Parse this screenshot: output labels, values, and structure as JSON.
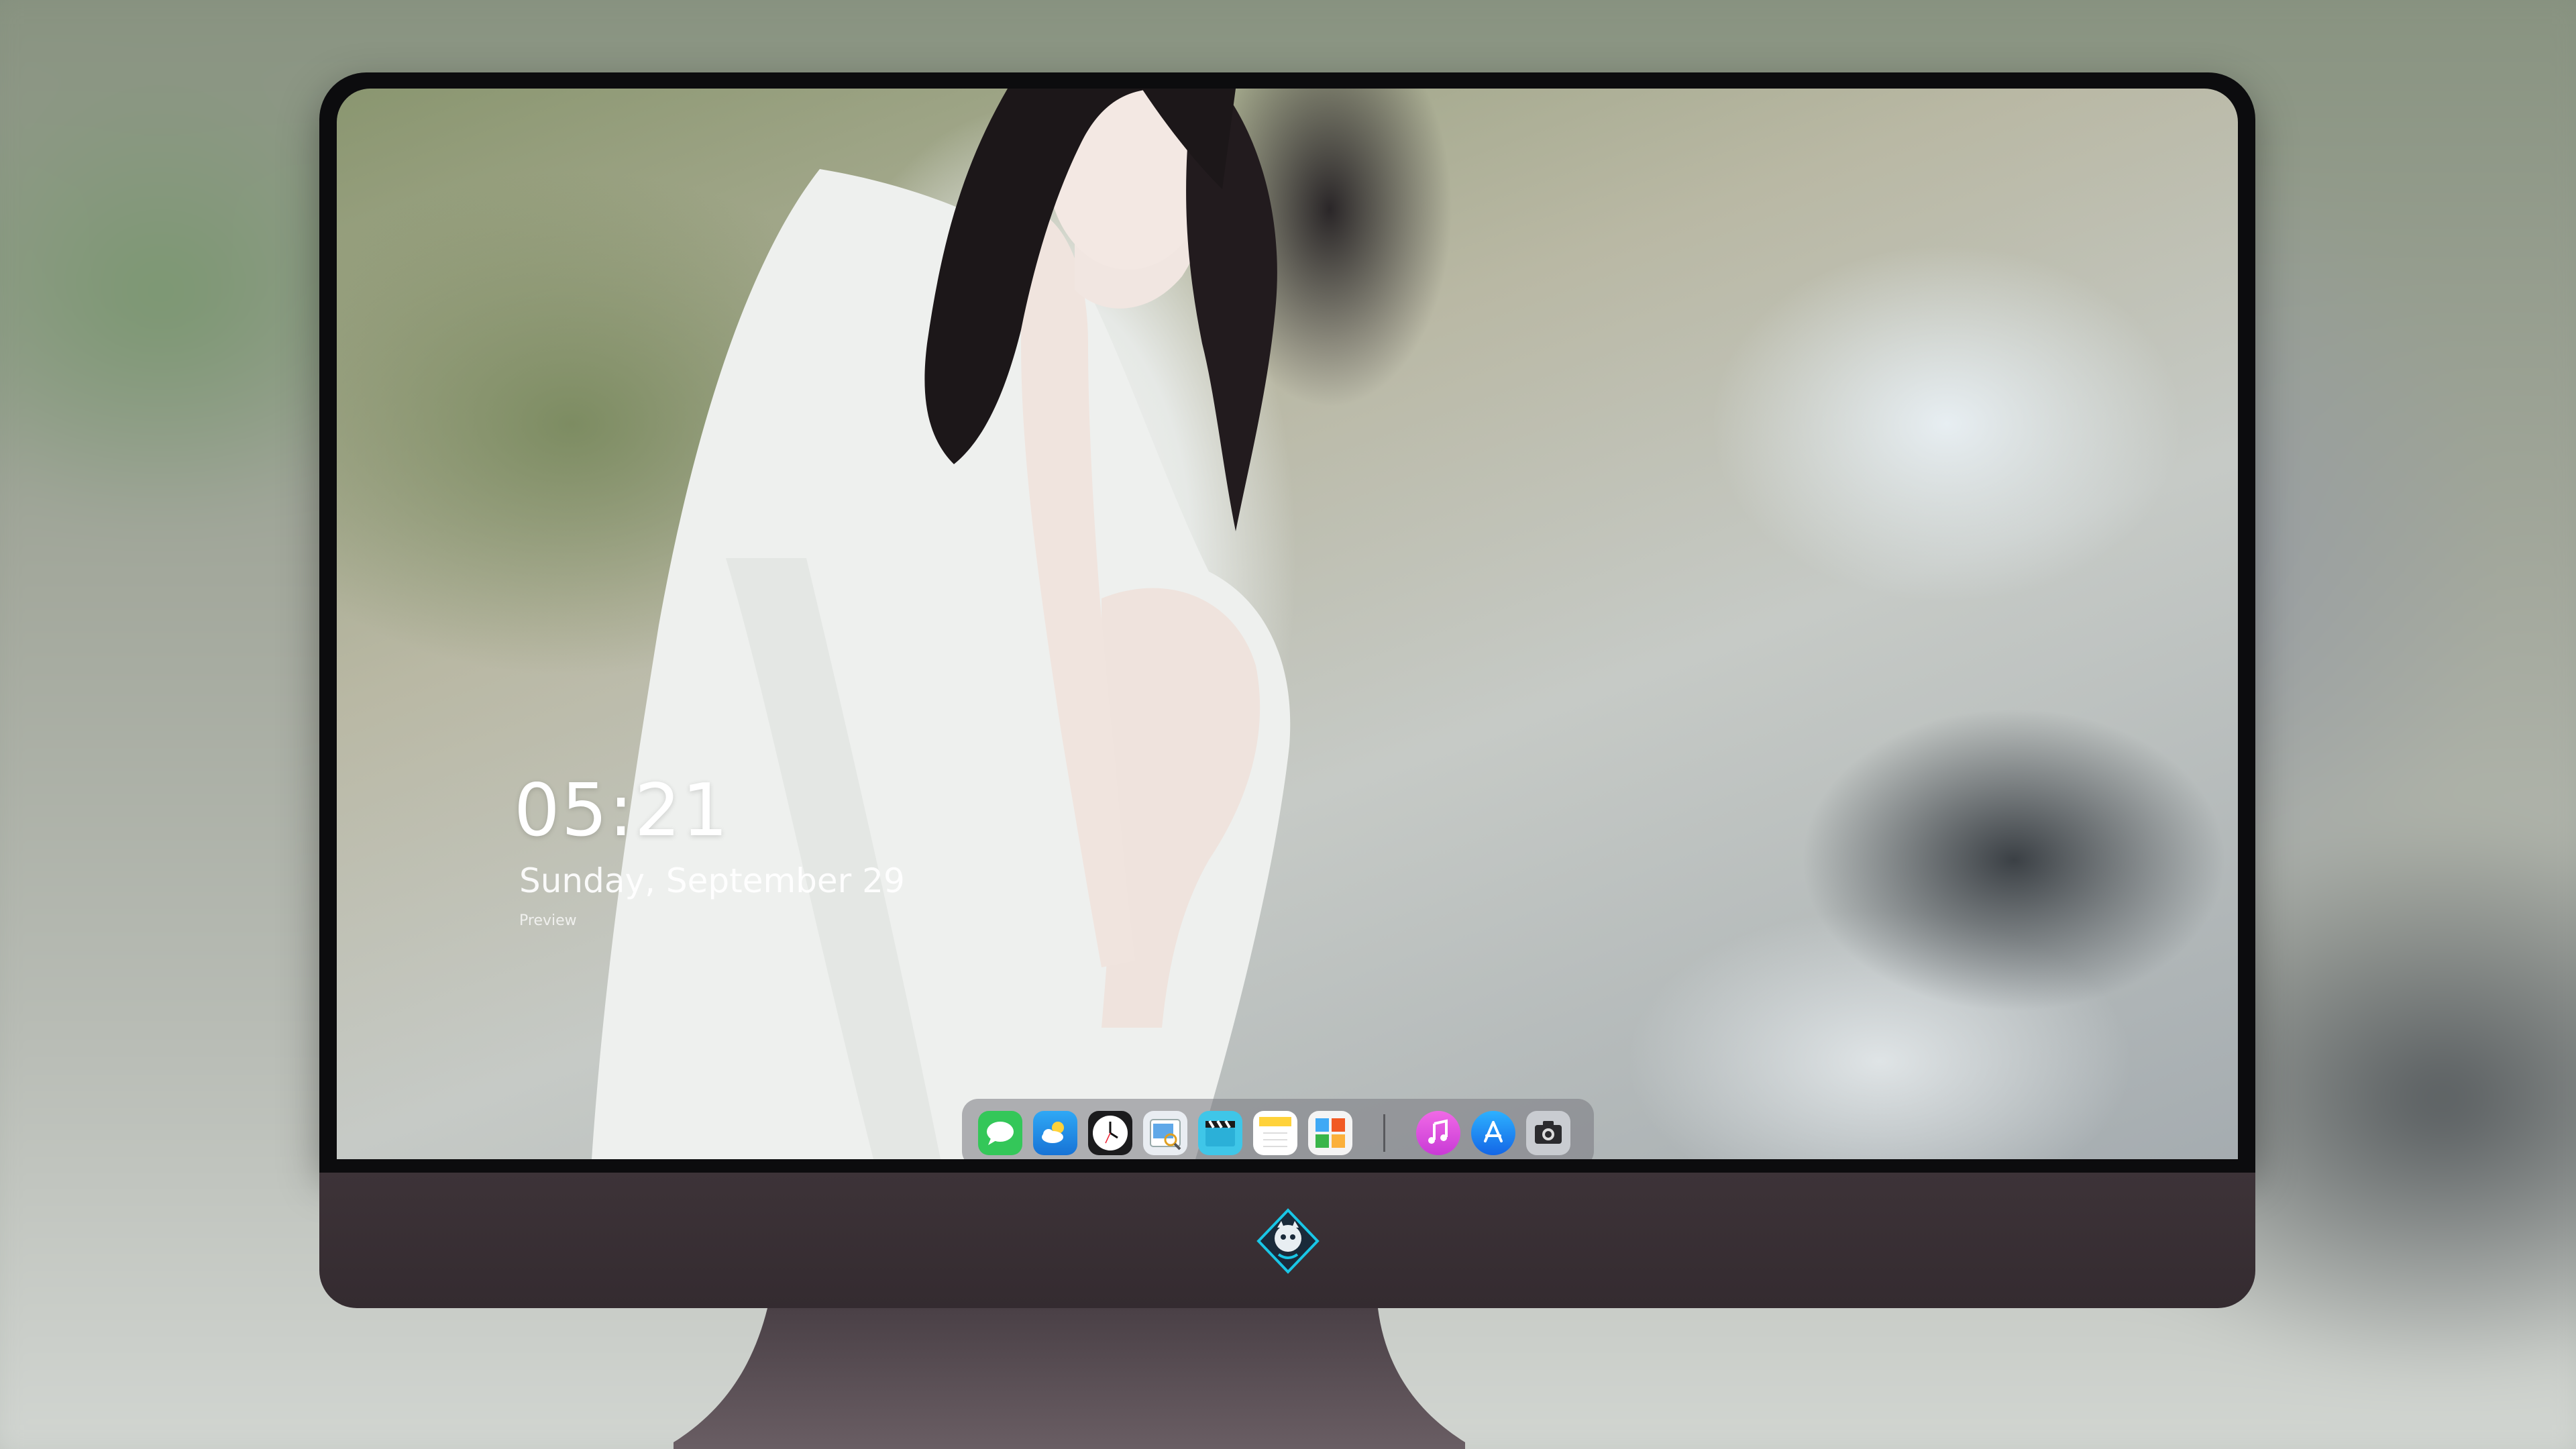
{
  "lockscreen": {
    "time": "05:21",
    "date": "Sunday, September 29",
    "preview": "Preview"
  },
  "dock": {
    "apps": [
      {
        "name": "Messages",
        "icon": "messages-icon"
      },
      {
        "name": "Weather",
        "icon": "weather-icon"
      },
      {
        "name": "Clock",
        "icon": "clock-icon"
      },
      {
        "name": "Preview",
        "icon": "preview-icon"
      },
      {
        "name": "Clips",
        "icon": "clapperboard-icon"
      },
      {
        "name": "Notes",
        "icon": "notes-icon"
      },
      {
        "name": "Photo Booth",
        "icon": "gallery-icon"
      },
      {
        "name": "Music",
        "icon": "music-icon"
      },
      {
        "name": "App Store",
        "icon": "app-store-icon"
      },
      {
        "name": "Screenshot",
        "icon": "camera-icon"
      }
    ]
  },
  "colors": {
    "messages": "#34c759",
    "weather": "#1e9cf0",
    "music": "#e84fd9",
    "appstore": "#1a8cff",
    "chin": "#3d3338",
    "logo_accent": "#19c6e6"
  }
}
